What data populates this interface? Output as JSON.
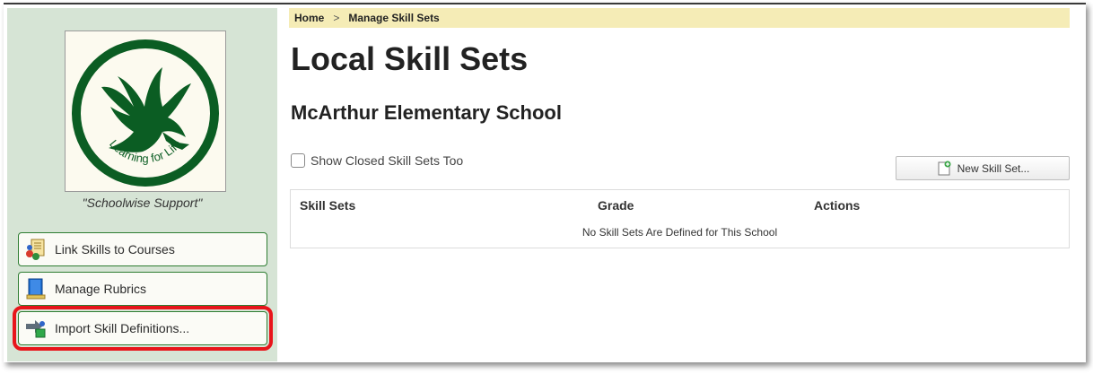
{
  "breadcrumb": {
    "home": "Home",
    "separator": ">",
    "current": "Manage Skill Sets"
  },
  "logo": {
    "text": "Learning for Life",
    "color": "#0b5d23"
  },
  "sidebar": {
    "motto": "\"Schoolwise Support\"",
    "buttons": [
      {
        "label": "Link Skills to Courses",
        "icon": "link-skills-icon"
      },
      {
        "label": "Manage Rubrics",
        "icon": "rubric-book-icon"
      },
      {
        "label": "Import Skill Definitions...",
        "icon": "import-icon"
      }
    ]
  },
  "main": {
    "title": "Local Skill Sets",
    "school": "McArthur Elementary School",
    "show_closed_label": "Show Closed Skill Sets Too",
    "show_closed_checked": false,
    "new_button_label": "New Skill Set...",
    "table": {
      "columns": [
        "Skill Sets",
        "Grade",
        "Actions"
      ],
      "empty_message": "No Skill Sets Are Defined for This School"
    }
  },
  "colors": {
    "sidebar_bg": "#d6e4d5",
    "breadcrumb_bg": "#f5ecb6",
    "accent_green": "#2e7d32",
    "highlight_red": "#e8151b"
  }
}
